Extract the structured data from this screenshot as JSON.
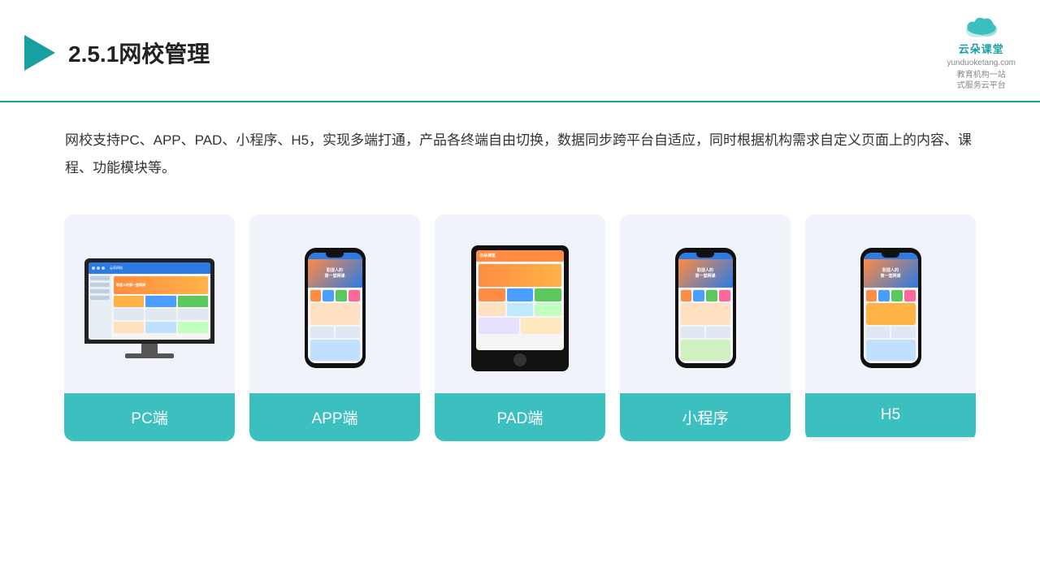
{
  "header": {
    "title": "2.5.1网校管理",
    "brand": {
      "name": "云朵课堂",
      "url": "yunduoketang.com",
      "tagline": "教育机构一站\n式服务云平台"
    }
  },
  "description": {
    "text": "网校支持PC、APP、PAD、小程序、H5，实现多端打通，产品各终端自由切换，数据同步跨平台自适应，同时根据机构需求自定义页面上的内容、课程、功能模块等。"
  },
  "cards": [
    {
      "id": "pc",
      "label": "PC端"
    },
    {
      "id": "app",
      "label": "APP端"
    },
    {
      "id": "pad",
      "label": "PAD端"
    },
    {
      "id": "miniprogram",
      "label": "小程序"
    },
    {
      "id": "h5",
      "label": "H5"
    }
  ],
  "colors": {
    "teal": "#3bbfbf",
    "accent": "#1a9fa0",
    "orange": "#ff8c42",
    "blue": "#2c7be5"
  }
}
